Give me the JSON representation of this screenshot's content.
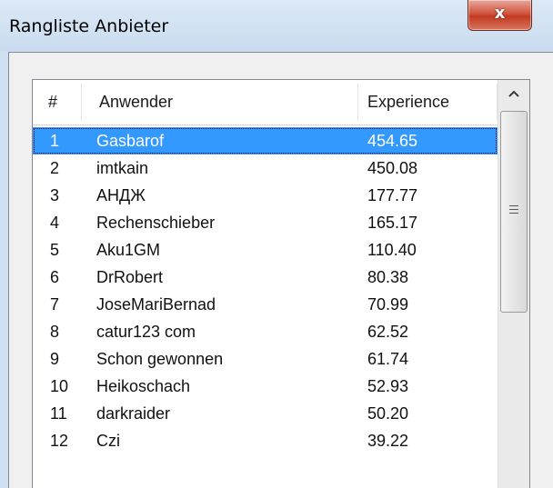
{
  "window": {
    "title": "Rangliste Anbieter",
    "close_label": "x"
  },
  "list": {
    "columns": [
      "#",
      "Anwender",
      "Experience"
    ],
    "rows": [
      {
        "num": "1",
        "user": "Gasbarof",
        "exp": "454.65",
        "selected": true
      },
      {
        "num": "2",
        "user": "imtkain",
        "exp": "450.08"
      },
      {
        "num": "3",
        "user": "АНДЖ",
        "exp": "177.77"
      },
      {
        "num": "4",
        "user": "Rechenschieber",
        "exp": "165.17"
      },
      {
        "num": "5",
        "user": "Aku1GM",
        "exp": "110.40"
      },
      {
        "num": "6",
        "user": "DrRobert",
        "exp": "80.38"
      },
      {
        "num": "7",
        "user": "JoseMariBernad",
        "exp": "70.99"
      },
      {
        "num": "8",
        "user": "catur123 com",
        "exp": "62.52"
      },
      {
        "num": "9",
        "user": "Schon gewonnen",
        "exp": "61.74"
      },
      {
        "num": "10",
        "user": "Heikoschach",
        "exp": "52.93"
      },
      {
        "num": "11",
        "user": "darkraider",
        "exp": "50.20"
      },
      {
        "num": "12",
        "user": "Czi",
        "exp": "39.22"
      }
    ]
  },
  "scrollbar": {
    "up_arrow_icon": "chevron-up-icon",
    "grip_icon": "scrollbar-grip-icon"
  },
  "colors": {
    "selection": "#3399ff",
    "close_button": "#c8472f"
  }
}
